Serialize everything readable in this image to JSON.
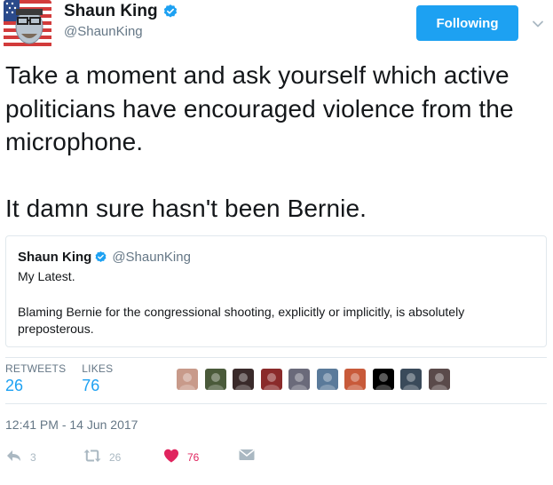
{
  "author": {
    "display_name": "Shaun King",
    "handle": "@ShaunKing",
    "verified": true,
    "avatar_icon": "profile-avatar"
  },
  "follow_button": {
    "label": "Following"
  },
  "tweet": {
    "paragraphs": [
      "Take a moment and ask yourself which active politicians have encouraged violence from the microphone.",
      "It damn sure hasn't been Bernie."
    ]
  },
  "quoted_tweet": {
    "display_name": "Shaun King",
    "handle": "@ShaunKing",
    "verified": true,
    "line1": "My Latest.",
    "body": "Blaming Bernie for the congressional shooting, explicitly or implicitly, is absolutely preposterous."
  },
  "stats": {
    "retweets_label": "RETWEETS",
    "retweets_value": "26",
    "likes_label": "LIKES",
    "likes_value": "76"
  },
  "likers": [
    {
      "name": "liker-avatar-1",
      "color": "#c89a8a"
    },
    {
      "name": "liker-avatar-2",
      "color": "#4a5a3a"
    },
    {
      "name": "liker-avatar-3",
      "color": "#3a2a2a"
    },
    {
      "name": "liker-avatar-4",
      "color": "#8a2a2a"
    },
    {
      "name": "liker-avatar-5",
      "color": "#6a6a7a"
    },
    {
      "name": "liker-avatar-6",
      "color": "#5a7a9a"
    },
    {
      "name": "liker-avatar-7",
      "color": "#c85a3a"
    },
    {
      "name": "liker-avatar-8",
      "color": "#000000"
    },
    {
      "name": "liker-avatar-9",
      "color": "#3a4a5a"
    },
    {
      "name": "liker-avatar-10",
      "color": "#5a4a4a"
    }
  ],
  "timestamp": "12:41 PM - 14 Jun 2017",
  "actions": {
    "reply_count": "3",
    "retweet_count": "26",
    "like_count": "76"
  },
  "colors": {
    "accent": "#1da1f2",
    "like": "#e0245e",
    "muted": "#657786",
    "icon_muted": "#aab8c2",
    "border": "#e1e8ed"
  }
}
